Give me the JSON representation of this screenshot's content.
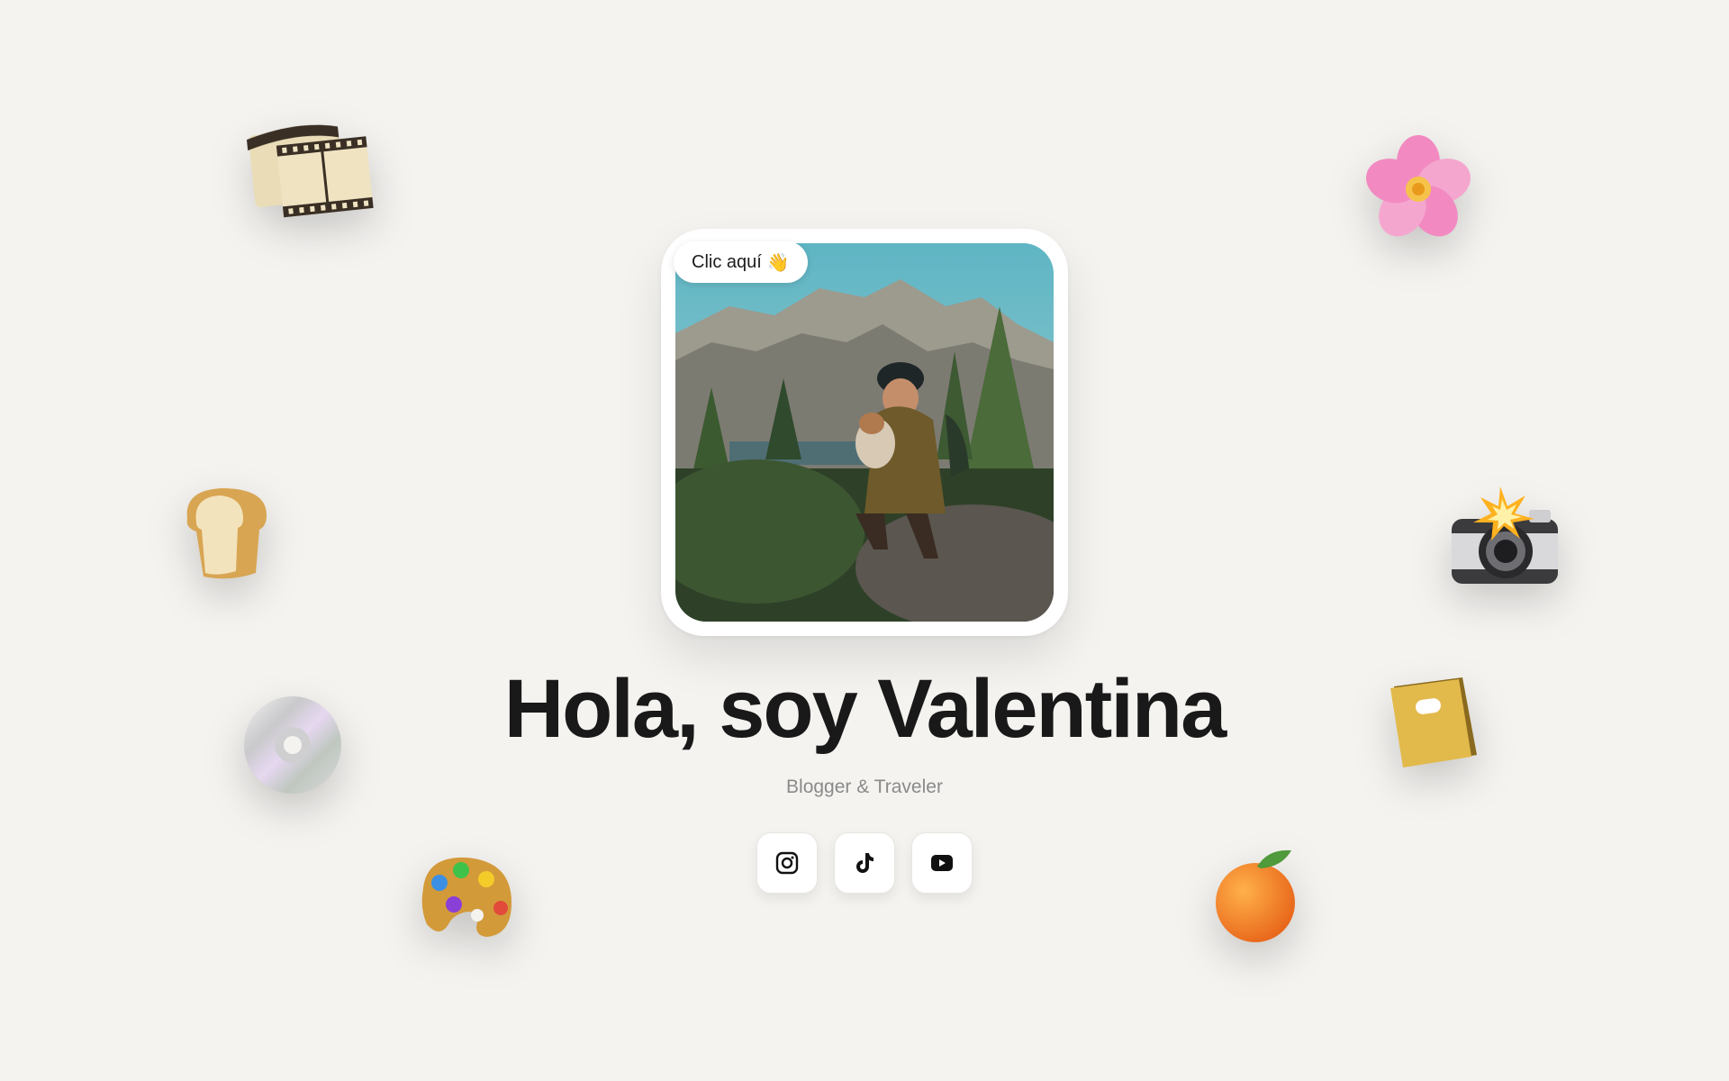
{
  "profile": {
    "photo_alt": "Hiker hugging a dog in the mountains",
    "click_label": "Clic aquí",
    "click_emoji": "👋"
  },
  "header": {
    "title": "Hola, soy Valentina",
    "subtitle": "Blogger & Traveler"
  },
  "socials": [
    {
      "name": "Instagram",
      "icon": "instagram-icon"
    },
    {
      "name": "TikTok",
      "icon": "tiktok-icon"
    },
    {
      "name": "YouTube",
      "icon": "youtube-icon"
    }
  ],
  "decorations": [
    "film-strip-icon",
    "flower-icon",
    "bread-icon",
    "camera-flash-icon",
    "cd-icon",
    "notebook-icon",
    "paint-palette-icon",
    "orange-icon"
  ],
  "colors": {
    "background": "#f4f3f0",
    "title": "#191919",
    "subtitle": "#8a8a8a"
  }
}
